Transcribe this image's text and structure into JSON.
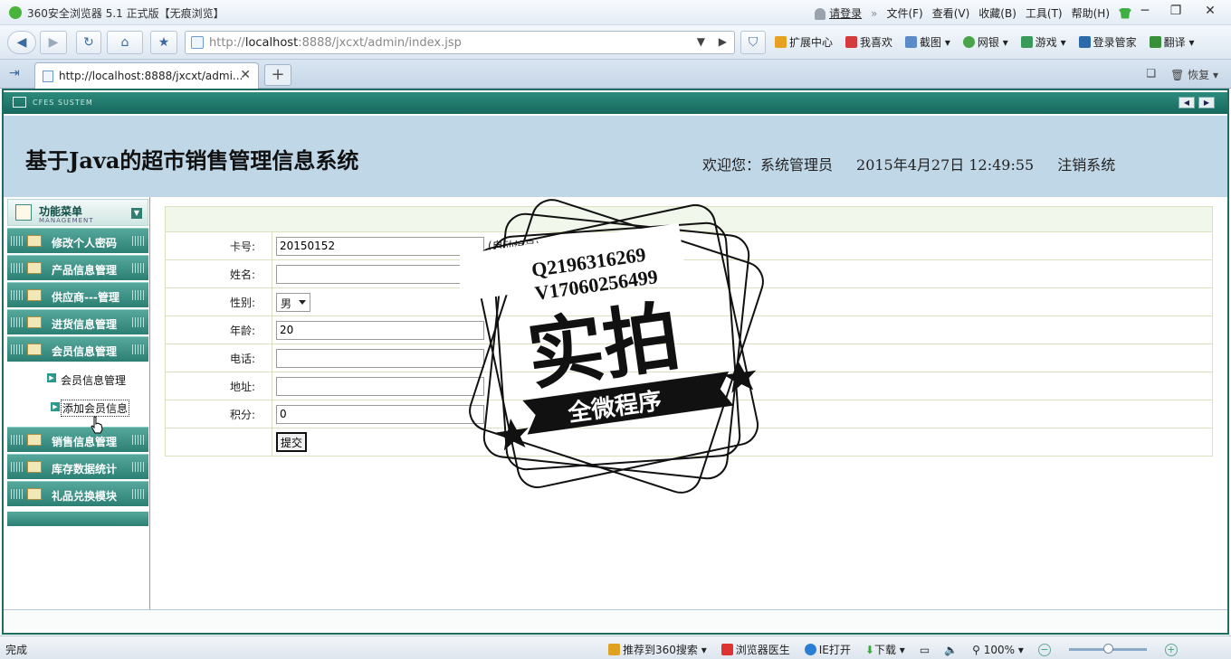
{
  "browser": {
    "window_title": "360安全浏览器 5.1 正式版【无痕浏览】",
    "login_link": "请登录",
    "menus": [
      "文件(F)",
      "查看(V)",
      "收藏(B)",
      "工具(T)",
      "帮助(H)"
    ],
    "window_controls": [
      "─",
      "❐",
      "✕"
    ],
    "address_prefix": "http://",
    "address_host": "localhost",
    "address_rest": ":8888/jxcxt/admin/index.jsp",
    "toolbar_items": [
      "扩展中心",
      "我喜欢",
      "截图",
      "网银",
      "游戏",
      "登录管家",
      "翻译"
    ],
    "tab_title": "http://localhost:8888/jxcxt/admi...",
    "restore_label": "恢复",
    "status_text": "完成",
    "status_items": [
      "推荐到360搜索",
      "浏览器医生",
      "IE打开",
      "下载",
      "100%"
    ]
  },
  "app": {
    "system_label": "CFES SUSTEM",
    "title": "基于Java的超市销售管理信息系统",
    "welcome": "欢迎您：系统管理员",
    "datetime": "2015年4月27日  12:49:55",
    "logout": "注销系统"
  },
  "menu": {
    "header_title": "功能菜单",
    "header_sub": "MANAGEMENT",
    "items_top": [
      "修改个人密码",
      "产品信息管理",
      "供应商---管理",
      "进货信息管理",
      "会员信息管理"
    ],
    "sub_items": [
      "会员信息管理",
      "添加会员信息"
    ],
    "items_bottom": [
      "销售信息管理",
      "库存数据统计",
      "礼品兑换模块"
    ]
  },
  "form": {
    "labels": [
      "卡号:",
      "姓名:",
      "性别:",
      "年龄:",
      "电话:",
      "地址:",
      "积分:"
    ],
    "card_no": "20150152",
    "card_hint": "(自动编号)",
    "name": "",
    "gender": "男",
    "age": "20",
    "phone": "",
    "address": "",
    "points": "0",
    "submit": "提交"
  },
  "watermark": {
    "line1": "Q2196316269",
    "line2": "V17060256499",
    "big_text": "实拍",
    "banner": "全微程序"
  }
}
